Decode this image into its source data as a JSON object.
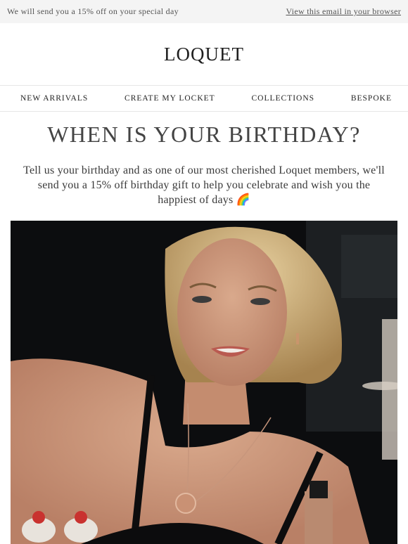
{
  "preheader": {
    "text": "We will send you a 15% off on your special day",
    "view_in_browser": "View this email in your browser"
  },
  "brand": {
    "logo": "LOQUET"
  },
  "nav": {
    "items": [
      "NEW ARRIVALS",
      "CREATE MY LOCKET",
      "COLLECTIONS",
      "BESPOKE"
    ]
  },
  "content": {
    "headline": "WHEN IS YOUR BIRTHDAY?",
    "intro": "Tell us your birthday and as one of our most cherished Loquet members, we'll send you a 15% off birthday gift to help you celebrate and wish you the happiest of days 🌈"
  },
  "hero": {
    "icon": "photo-woman-locket-necklace"
  },
  "colors": {
    "preheader_bg": "#f4f4f4",
    "text": "#3a3a3a",
    "divider": "#e6e6e6"
  }
}
